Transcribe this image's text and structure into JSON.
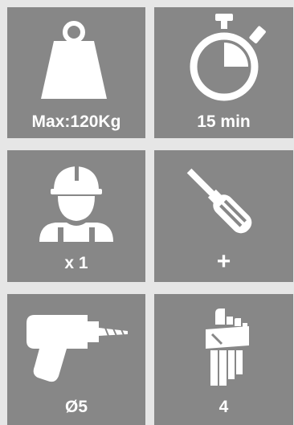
{
  "tiles": [
    {
      "icon": "weight-icon",
      "caption": "Max:120Kg"
    },
    {
      "icon": "stopwatch-icon",
      "caption": "15 min"
    },
    {
      "icon": "worker-icon",
      "caption": "x 1"
    },
    {
      "icon": "screwdriver-icon",
      "caption": "+"
    },
    {
      "icon": "drill-icon",
      "caption": "Ø5"
    },
    {
      "icon": "hex-keys-icon",
      "caption": "4"
    }
  ],
  "colors": {
    "tile": "#878787",
    "background": "#e6e6e6",
    "foreground": "#ffffff"
  }
}
